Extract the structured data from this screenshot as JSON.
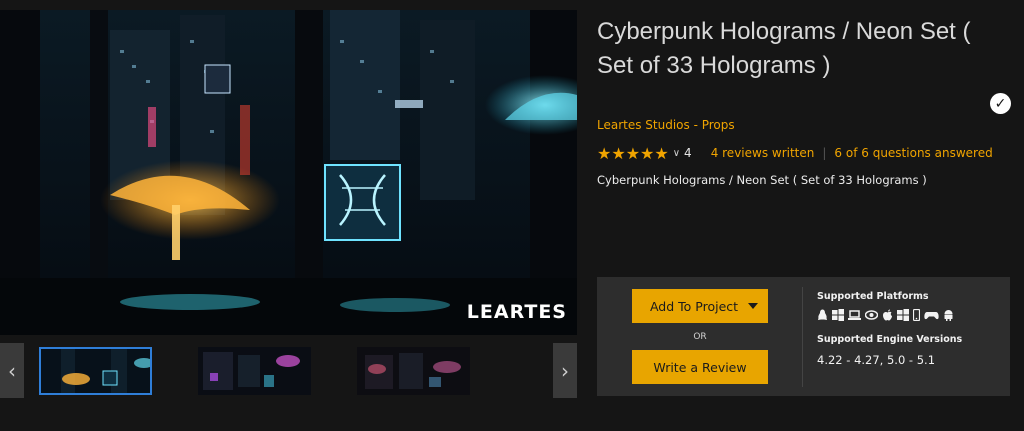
{
  "product": {
    "title": "Cyberpunk Holograms / Neon Set ( Set of 33 Holograms )",
    "seller": "Leartes Studios - Props",
    "rating": {
      "stars": "★★★★★",
      "dropdown": "∨",
      "count": "4",
      "reviews_link": "4 reviews written",
      "divider": "|",
      "questions_link": "6 of 6 questions answered"
    },
    "subtitle": "Cyberpunk Holograms / Neon Set ( Set of 33 Holograms )",
    "verified_glyph": "✓"
  },
  "gallery": {
    "watermark": "LEARTES",
    "prev_arrow": "‹",
    "next_arrow": "›",
    "active_thumbnail": 1
  },
  "actions": {
    "add_to_project": "Add To Project",
    "or": "OR",
    "write_review": "Write a Review"
  },
  "platforms": {
    "heading": "Supported Platforms",
    "icons": [
      "linux-icon",
      "windows-icon",
      "laptop-icon",
      "eye-icon",
      "apple-icon",
      "windows-icon",
      "phone-icon",
      "gamepad-icon",
      "android-icon"
    ]
  },
  "engine": {
    "heading": "Supported Engine Versions",
    "versions": "4.22 - 4.27, 5.0 - 5.1"
  },
  "colors": {
    "background": "#151515",
    "accent": "#f0a400",
    "button": "#e8a500",
    "panel": "#2d2d2d",
    "active_thumb_border": "#2f7ed8"
  }
}
